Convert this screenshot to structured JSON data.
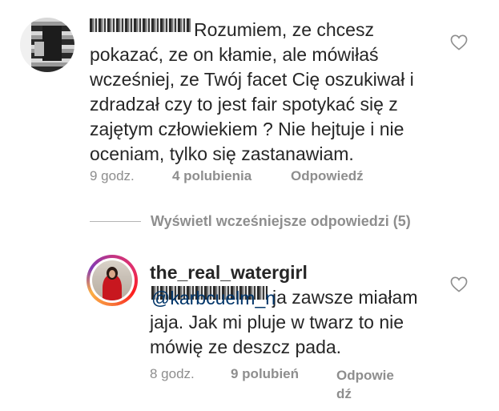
{
  "comments": [
    {
      "username": "karbcuelm_n",
      "text": "Rozumiem, ze chcesz pokazać, ze on kłamie, ale mówiłaś wcześniej, ze Twój facet Cię oszukiwał i zdradzał czy to jest fair spotykać się z zajętym człowiekiem ? Nie hejtuje i nie oceniam, tylko się zastanawiam.",
      "time": "9 godz.",
      "likes": "4 polubienia",
      "reply": "Odpowiedź"
    },
    {
      "username": "the_real_watergirl",
      "mention": "@karbcuelm_n",
      "text": "ja zawsze miałam jaja. Jak mi pluje w twarz to nie mówię ze deszcz pada.",
      "time": "8 godz.",
      "likes": "9 polubień",
      "reply": "Odpowie dź"
    }
  ],
  "view_replies": {
    "label": "Wyświetl wcześniejsze odpowiedzi (5)"
  },
  "icons": {
    "like": "heart-outline-icon"
  },
  "colors": {
    "text": "#262626",
    "secondary": "#8e8e8e",
    "mention": "#003569"
  }
}
